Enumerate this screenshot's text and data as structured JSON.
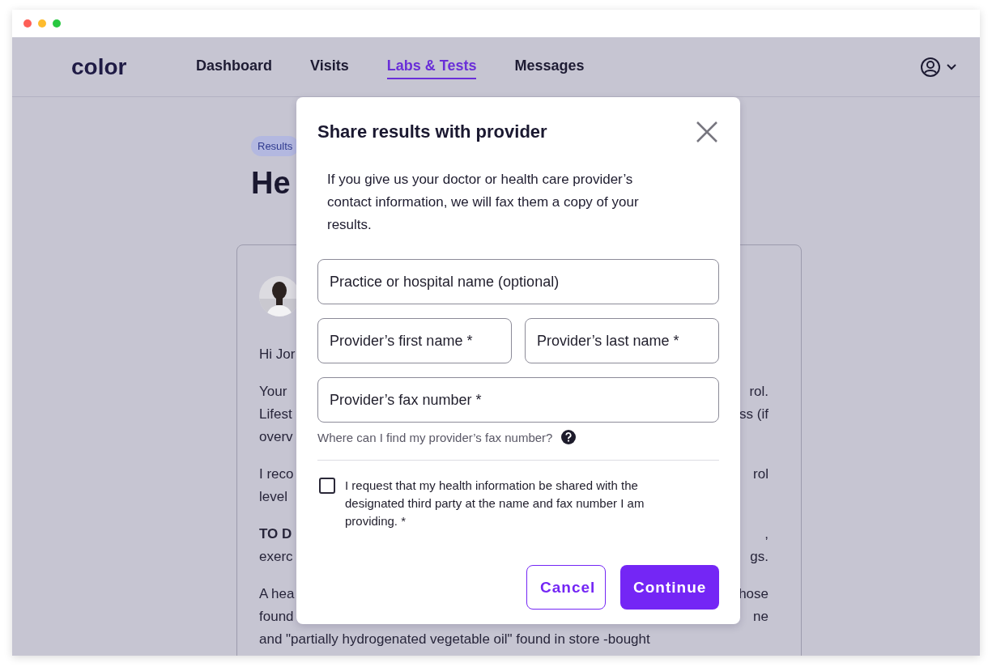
{
  "nav": {
    "logo": "color",
    "tabs": [
      {
        "label": "Dashboard",
        "selected": false
      },
      {
        "label": "Visits",
        "selected": false
      },
      {
        "label": "Labs & Tests",
        "selected": true
      },
      {
        "label": "Messages",
        "selected": false
      }
    ]
  },
  "page": {
    "badge": "Results",
    "title": "He",
    "paragraphs": [
      {
        "lines": [
          {
            "left": "Hi Jor",
            "bold": false
          }
        ]
      },
      {
        "lines": [
          {
            "left": "Your",
            "right": "rol.",
            "bold": false
          },
          {
            "left": "Lifest",
            "right": "ss (if",
            "bold": false
          },
          {
            "left": "overv",
            "bold": false
          }
        ]
      },
      {
        "lines": [
          {
            "left": "I reco",
            "right": "rol",
            "bold": false
          },
          {
            "left": "level",
            "bold": false
          }
        ]
      },
      {
        "lines": [
          {
            "left": "TO D",
            "right": ",",
            "bold": true
          },
          {
            "left": "exerc",
            "right": "gs.",
            "bold": false
          }
        ]
      },
      {
        "lines": [
          {
            "left": "A hea",
            "right": "hose",
            "bold": false
          },
          {
            "left": "found",
            "right": "ne",
            "bold": false
          },
          {
            "left": "and \"partially hydrogenated vegetable oil\" found in store -bought",
            "bold": false
          }
        ]
      }
    ]
  },
  "modal": {
    "title": "Share results with provider",
    "intro": "If you give us your doctor or health care provider’s contact information, we will fax them a copy of your results.",
    "fields": [
      {
        "placeholder": "Practice or hospital name (optional)"
      },
      {
        "placeholder": "Provider’s first name *"
      },
      {
        "placeholder": "Provider’s last name *"
      },
      {
        "placeholder": "Provider’s fax number *"
      }
    ],
    "help": "Where can I find my provider’s fax number?",
    "consent": {
      "label": "I request that my health information be shared with the designated third party at the name and fax number I am providing. *",
      "checked": false
    },
    "buttons": [
      {
        "label": "Cancel",
        "kind": "secondary"
      },
      {
        "label": "Continue",
        "kind": "primary"
      }
    ]
  }
}
